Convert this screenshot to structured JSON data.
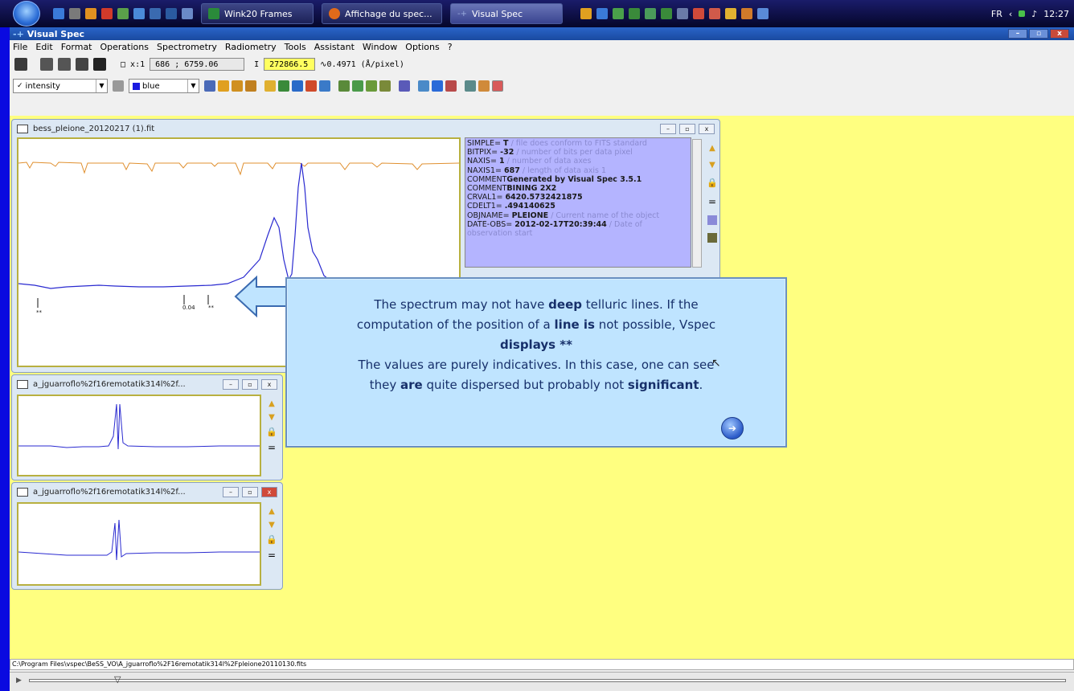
{
  "taskbar": {
    "tasks": [
      {
        "label": "Wink20 Frames"
      },
      {
        "label": "Affichage du spec..."
      },
      {
        "label": "Visual Spec"
      }
    ],
    "lang": "FR",
    "time": "12:27"
  },
  "app": {
    "title": "Visual Spec",
    "menu": [
      "File",
      "Edit",
      "Format",
      "Operations",
      "Spectrometry",
      "Radiometry",
      "Tools",
      "Assistant",
      "Window",
      "Options",
      "?"
    ]
  },
  "toolbar1": {
    "xcoord_label": "x:1",
    "xcoord_value": "686 ; 6759.06",
    "intensity_label": "I",
    "intensity_value": "272866.5",
    "dispersion": "0.4971 (Å/pixel)"
  },
  "toolbar2": {
    "display_combo": "intensity",
    "color_combo": "blue"
  },
  "windows": {
    "main": {
      "title": "bess_pleione_20120217 (1).fit",
      "markers": [
        "**",
        "0.04",
        "**"
      ]
    },
    "child1": {
      "title": "a_jguarroflo%2f16remotatik314l%2f..."
    },
    "child2": {
      "title": "a_jguarroflo%2f16remotatik314l%2f..."
    }
  },
  "fits_header": [
    {
      "key": "SIMPLE",
      "val": "T",
      "comment": "/ file does conform to FITS standard"
    },
    {
      "key": "BITPIX",
      "val": "-32",
      "comment": "/ number of bits per data pixel"
    },
    {
      "key": "NAXIS",
      "val": "1",
      "comment": "/ number of data axes"
    },
    {
      "key": "NAXIS1",
      "val": "687",
      "comment": "/ length of data axis 1"
    },
    {
      "key": "COMMENT",
      "val": "Generated by Visual Spec 3.5.1",
      "comment": ""
    },
    {
      "key": "COMMENT",
      "val": "BINING 2X2",
      "comment": ""
    },
    {
      "key": "CRVAL1",
      "val": "6420.5732421875",
      "comment": ""
    },
    {
      "key": "CDELT1",
      "val": ".494140625",
      "comment": ""
    },
    {
      "key": "OBJNAME",
      "val": "PLEIONE",
      "comment": "/ Current name of the object"
    },
    {
      "key": "DATE-OBS",
      "val": "2012-02-17T20:39:44",
      "comment": "/ Date of observation start"
    }
  ],
  "callout": {
    "line1a": "The spectrum may not have",
    "line1b": "deep",
    "line1c": "telluric lines. If the",
    "line2a": "computation of the position of a",
    "line2b": "line is",
    "line2c": "not possible, Vspec",
    "line3": "displays **",
    "line4": "The values are purely indicatives. In this case, one can see",
    "line5a": "they",
    "line5b": "are",
    "line5c": "quite dispersed but probably not",
    "line5d": "significant",
    "line5e": "."
  },
  "status": {
    "path": "C:\\Program Files\\vspec\\BeSS_VO\\A_jguarroflo%2F16remotatik314l%2Fpleione20110130.fits"
  }
}
